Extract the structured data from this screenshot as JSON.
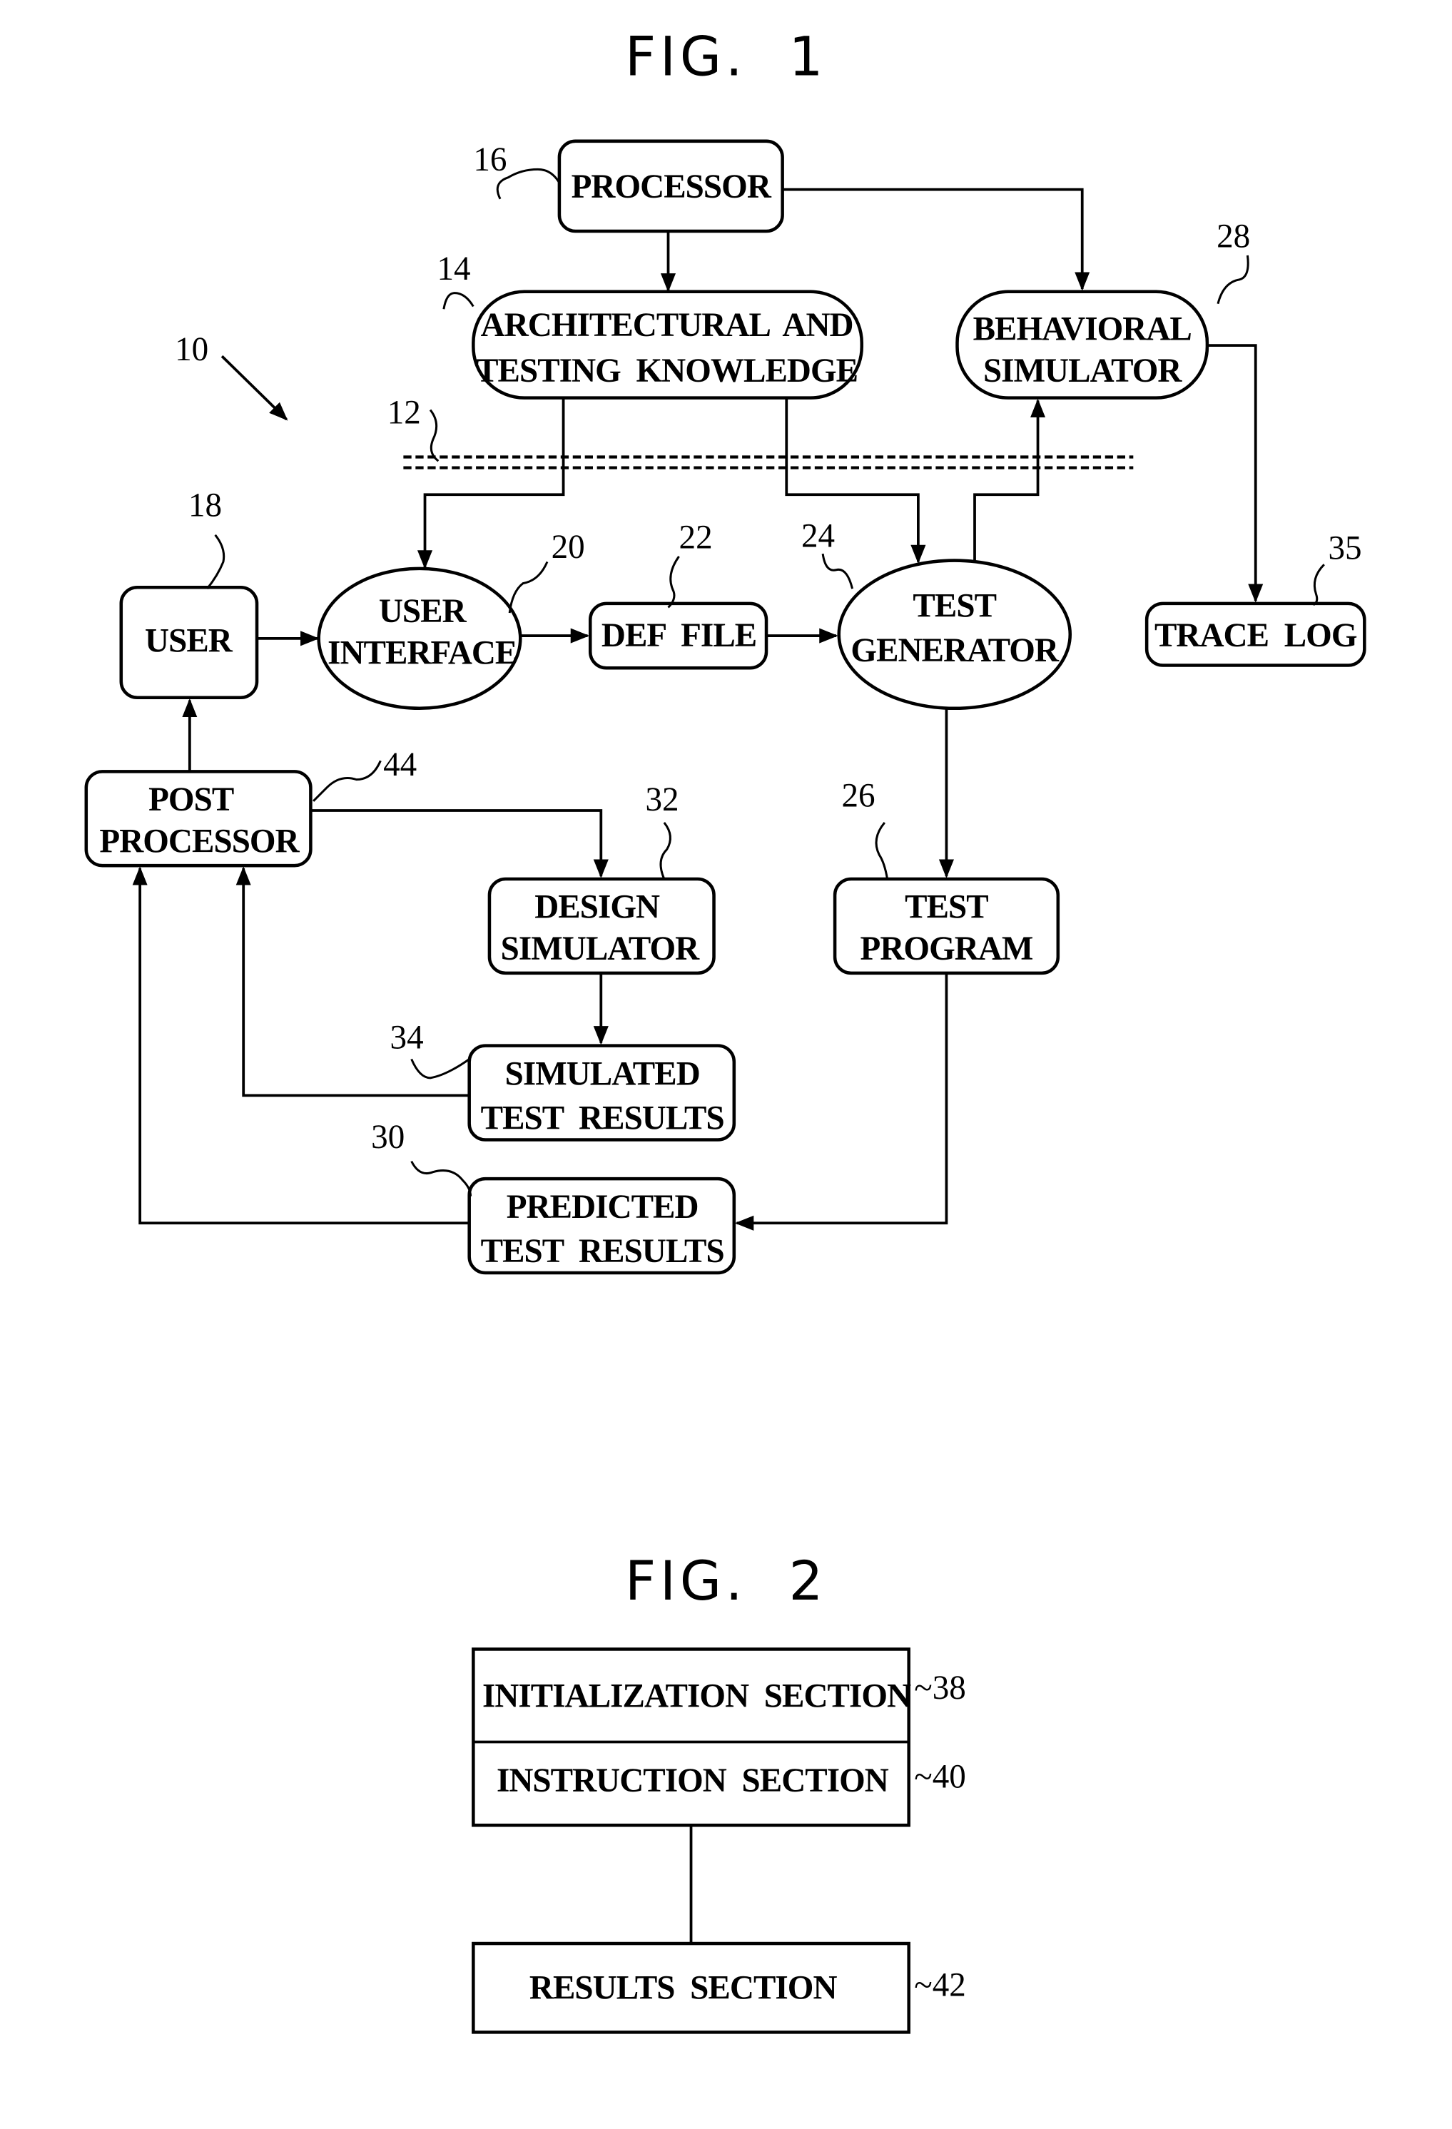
{
  "fig1": {
    "title": "FIG.  1",
    "system_ref": "10",
    "network_ref": "12",
    "nodes": {
      "processor": {
        "label": "PROCESSOR",
        "ref": "16"
      },
      "knowledge": {
        "line1": "ARCHITECTURAL  AND",
        "line2": "TESTING  KNOWLEDGE",
        "ref": "14"
      },
      "behavioral": {
        "line1": "BEHAVIORAL",
        "line2": "SIMULATOR",
        "ref": "28"
      },
      "user": {
        "label": "USER",
        "ref": "18"
      },
      "user_interface": {
        "line1": "USER",
        "line2": "INTERFACE",
        "ref": "20"
      },
      "def_file": {
        "label": "DEF  FILE",
        "ref": "22"
      },
      "test_generator": {
        "line1": "TEST",
        "line2": "GENERATOR",
        "ref": "24"
      },
      "trace_log": {
        "label": "TRACE  LOG",
        "ref": "35"
      },
      "post_processor": {
        "line1": "POST",
        "line2": "PROCESSOR",
        "ref": "44"
      },
      "design_simulator": {
        "line1": "DESIGN",
        "line2": "SIMULATOR",
        "ref": "32"
      },
      "test_program": {
        "line1": "TEST",
        "line2": "PROGRAM",
        "ref": "26"
      },
      "simulated_results": {
        "line1": "SIMULATED",
        "line2": "TEST  RESULTS",
        "ref": "34"
      },
      "predicted_results": {
        "line1": "PREDICTED",
        "line2": "TEST  RESULTS",
        "ref": "30"
      }
    }
  },
  "fig2": {
    "title": "FIG.  2",
    "sections": [
      {
        "label": "INITIALIZATION  SECTION",
        "ref": "~38"
      },
      {
        "label": "INSTRUCTION  SECTION",
        "ref": "~40"
      },
      {
        "label": "RESULTS  SECTION",
        "ref": "~42"
      }
    ]
  }
}
